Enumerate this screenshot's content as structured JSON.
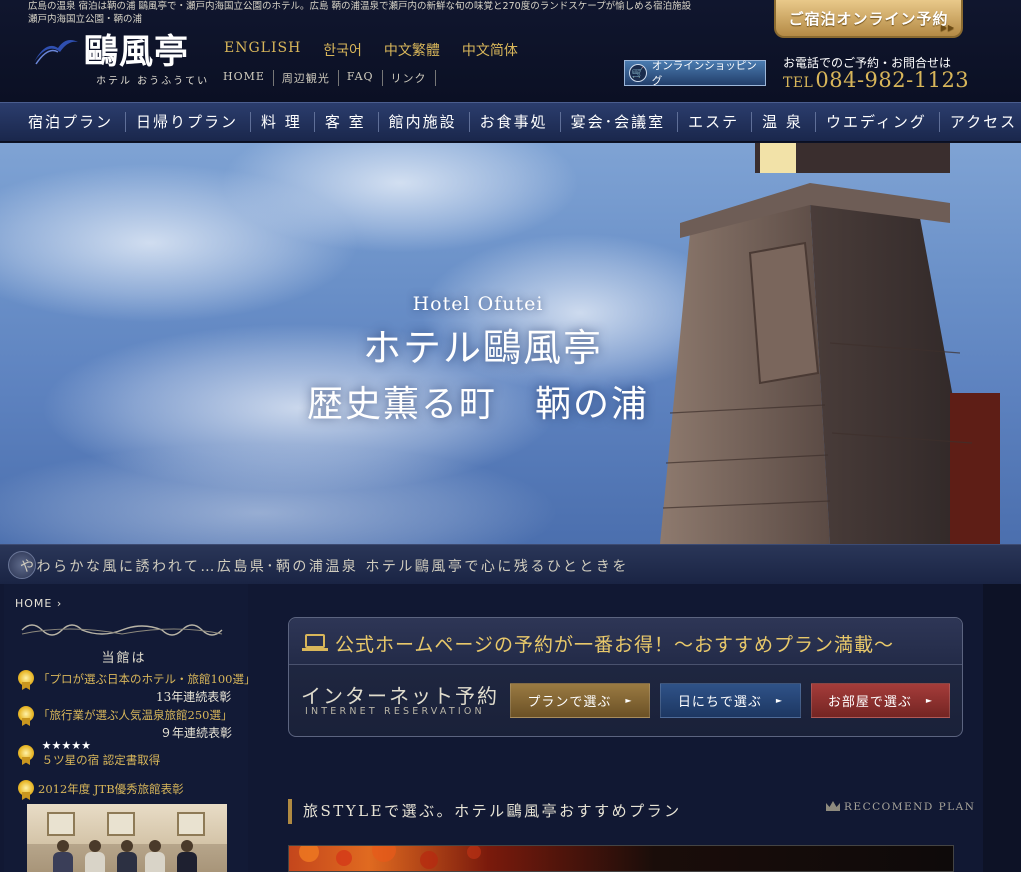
{
  "header": {
    "top_text_line1": "広島の温泉 宿泊は鞆の浦 鷗風亭で・瀬戸内海国立公園のホテル。広島 鞆の浦温泉で瀬戸内の新鮮な旬の味覚と270度のランドスケープが愉しめる宿泊施設",
    "top_text_line2": "瀬戸内海国立公園・鞆の浦",
    "logo_name": "鷗風亭",
    "logo_sub": "ホテル おうふうてい",
    "languages": [
      "ENGLISH",
      "한국어",
      "中文繁體",
      "中文简体"
    ],
    "sub_links": [
      "HOME",
      "周辺観光",
      "FAQ",
      "リンク"
    ],
    "reserve_button": "ご宿泊オンライン予約",
    "shop_button": "オンラインショッピング",
    "tel_label": "お電話でのご予約・お問合せは",
    "tel_prefix": "TEL",
    "tel_number": "084-982-1123"
  },
  "nav": {
    "items": [
      "宿泊プラン",
      "日帰りプラン",
      "料 理",
      "客 室",
      "館内施設",
      "お食事処",
      "宴会･会議室",
      "エステ",
      "温 泉",
      "ウエディング",
      "アクセス"
    ]
  },
  "hero": {
    "title_en": "Hotel Ofutei",
    "title_jp": "ホテル鷗風亭",
    "subtitle": "歴史薫る町　鞆の浦"
  },
  "tagline": "やわらかな風に誘われて…広島県･鞆の浦温泉 ホテル鷗風亭で心に残るひとときを",
  "sidebar": {
    "breadcrumb": "HOME",
    "title": "当館は",
    "awards": [
      {
        "title": "「プロが選ぶ日本のホテル・旅館100選」",
        "sub": "13年連続表彰"
      },
      {
        "title": "「旅行業が選ぶ人気温泉旅館250選」",
        "sub": "９年連続表彰"
      },
      {
        "stars": "★★★★★",
        "title": "５ツ星の宿 認定書取得"
      },
      {
        "title": "2012年度 JTB優秀旅館表彰"
      }
    ]
  },
  "reservation": {
    "header": "公式ホームページの予約が一番お得！～おすすめプラン満載～",
    "internet_jp": "インターネット予約",
    "internet_en": "INTERNET RESERVATION",
    "buttons": [
      "プランで選ぶ",
      "日にちで選ぶ",
      "お部屋で選ぶ"
    ],
    "button_arrow": "►"
  },
  "recommend": {
    "title": "旅STYLEで選ぶ。ホテル鷗風亭おすすめプラン",
    "title_en": "RECCOMEND PLAN"
  },
  "colors": {
    "gold": "#d8b65a",
    "navy": "#0d1226",
    "nav_blue": "#2b3d6d"
  }
}
